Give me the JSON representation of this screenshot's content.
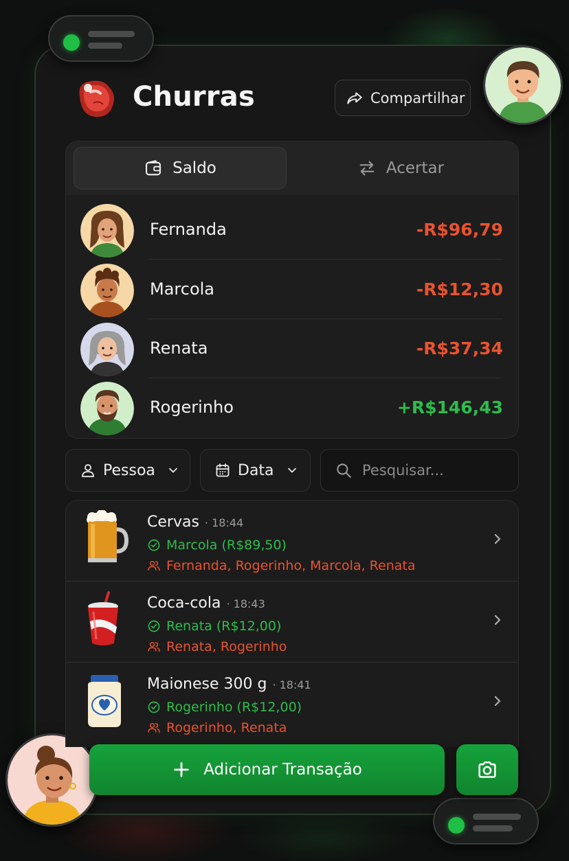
{
  "app": {
    "title": "Churras",
    "share_label": "Compartilhar"
  },
  "tabs": [
    {
      "label": "Saldo",
      "icon": "wallet-icon",
      "active": true
    },
    {
      "label": "Acertar",
      "icon": "swap-arrows-icon",
      "active": false
    }
  ],
  "balances": [
    {
      "name": "Fernanda",
      "amount": "-R$96,79",
      "status": "negative"
    },
    {
      "name": "Marcola",
      "amount": "-R$12,30",
      "status": "negative"
    },
    {
      "name": "Renata",
      "amount": "-R$37,34",
      "status": "negative"
    },
    {
      "name": "Rogerinho",
      "amount": "+R$146,43",
      "status": "positive"
    }
  ],
  "filters": {
    "person_label": "Pessoa",
    "date_label": "Data",
    "search_placeholder": "Pesquisar..."
  },
  "transactions": [
    {
      "name": "Cervas",
      "time": "· 18:44",
      "payer": "Marcola (R$89,50)",
      "split": "Fernanda, Rogerinho, Marcola, Renata",
      "icon": "beer-mug-icon"
    },
    {
      "name": "Coca-cola",
      "time": "· 18:43",
      "payer": "Renata (R$12,00)",
      "split": "Renata, Rogerinho",
      "icon": "soda-cup-icon"
    },
    {
      "name": "Maionese 300 g",
      "time": "· 18:41",
      "payer": "Rogerinho (R$12,00)",
      "split": "Rogerinho, Renata",
      "icon": "mayonnaise-jar-icon"
    }
  ],
  "actions": {
    "add_label": "Adicionar Transação",
    "camera_icon": "camera-icon"
  },
  "colors": {
    "accent_green": "#16a23b",
    "negative": "#e9532f",
    "positive": "#2dbd4c",
    "background": "#171717"
  }
}
